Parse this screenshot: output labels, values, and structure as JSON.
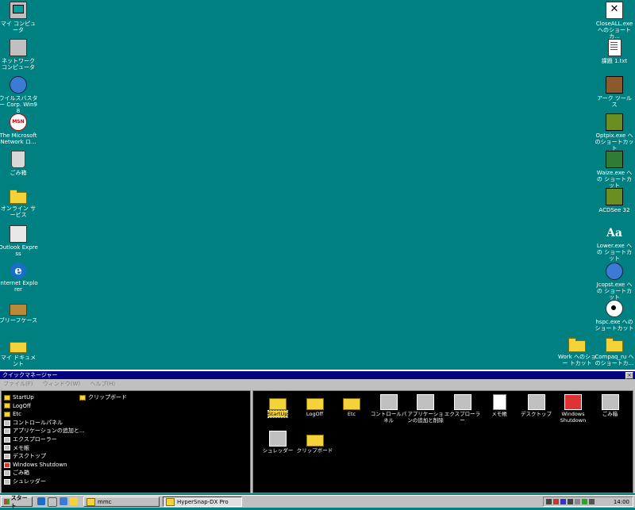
{
  "desktop": {
    "left_icons": [
      {
        "label": "マイ コンピュータ",
        "icon": "computer-icon"
      },
      {
        "label": "ネットワーク コンピュータ",
        "icon": "network-icon"
      },
      {
        "label": "ウイルスバスター Corp. Win98",
        "icon": "antivirus-icon"
      },
      {
        "label": "The Microsoft Network ロ...",
        "icon": "msn-icon"
      },
      {
        "label": "ごみ箱",
        "icon": "recycle-bin-icon"
      },
      {
        "label": "オンライン サービス",
        "icon": "folder-icon"
      },
      {
        "label": "Outlook Express",
        "icon": "outlook-icon"
      },
      {
        "label": "Internet Explorer",
        "icon": "ie-icon"
      },
      {
        "label": "ブリーフケース",
        "icon": "briefcase-icon"
      },
      {
        "label": "マイ ドキュメント",
        "icon": "my-documents-icon"
      }
    ],
    "right_icons": [
      {
        "label": "CloseALL.exe へのショートカ...",
        "icon": "close-all-icon"
      },
      {
        "label": "課題 1.txt",
        "icon": "text-file-icon"
      },
      {
        "label": "アーク ツールス",
        "icon": "archive-tool-icon"
      },
      {
        "label": "Optpix.exe へ のショートカット",
        "icon": "optpix-icon"
      },
      {
        "label": "Waize.exe への ショートカット",
        "icon": "waize-icon"
      },
      {
        "label": "ACDSee 32",
        "icon": "acdsee-icon"
      },
      {
        "label": "Lower.exe への ショートカット",
        "icon": "font-icon"
      },
      {
        "label": "Jcopst.exe への ショートカット",
        "icon": "globe-icon"
      },
      {
        "label": "hspc.exe への ショートカット",
        "icon": "eye-icon"
      }
    ],
    "bottom_icons": [
      {
        "label": "Work へのショー トカット",
        "icon": "folder-icon"
      },
      {
        "label": "Compaq_ru へ のショートカ...",
        "icon": "folder-icon"
      }
    ]
  },
  "quick_manager": {
    "title": "クイックマネージャー",
    "close": "×",
    "menu": [
      "ファイル(F)",
      "ウィンドウ(W)",
      "ヘルプ(H)"
    ],
    "tree": [
      {
        "label": "StartUp",
        "kind": "folder"
      },
      {
        "label": "LogOff",
        "kind": "folder"
      },
      {
        "label": "Etc",
        "kind": "folder"
      },
      {
        "label": "コントロールパネル",
        "kind": "sys"
      },
      {
        "label": "アプリケーションの追加と...",
        "kind": "sys"
      },
      {
        "label": "エクスプローラー",
        "kind": "sys"
      },
      {
        "label": "メモ帳",
        "kind": "sys"
      },
      {
        "label": "デスクトップ",
        "kind": "sys"
      },
      {
        "label": "Windows Shutdown",
        "kind": "red"
      },
      {
        "label": "ごみ箱",
        "kind": "sys"
      },
      {
        "label": "シュレッダー",
        "kind": "sys"
      }
    ],
    "clip_tree": [
      {
        "label": "クリップボード",
        "kind": "folder"
      }
    ],
    "items": [
      {
        "label": "StartUp",
        "kind": "folder",
        "selected": true
      },
      {
        "label": "LogOff",
        "kind": "folder"
      },
      {
        "label": "Etc",
        "kind": "folder"
      },
      {
        "label": "コントロールパネル",
        "kind": "sys"
      },
      {
        "label": "アプリケーションの追加と削除",
        "kind": "sys"
      },
      {
        "label": "エクスプローラー",
        "kind": "sys"
      },
      {
        "label": "メモ帳",
        "kind": "doc"
      },
      {
        "label": "デスクトップ",
        "kind": "sys"
      },
      {
        "label": "Windows Shutdown",
        "kind": "win"
      },
      {
        "label": "ごみ箱",
        "kind": "sys"
      },
      {
        "label": "シュレッダー",
        "kind": "sys"
      },
      {
        "label": "クリップボード",
        "kind": "folder"
      }
    ]
  },
  "taskbar": {
    "start_label": "スタート",
    "tasks": [
      {
        "label": "mmc",
        "active": false
      },
      {
        "label": "HyperSnap-DX Pro",
        "active": true
      }
    ],
    "clock": "14:00"
  }
}
